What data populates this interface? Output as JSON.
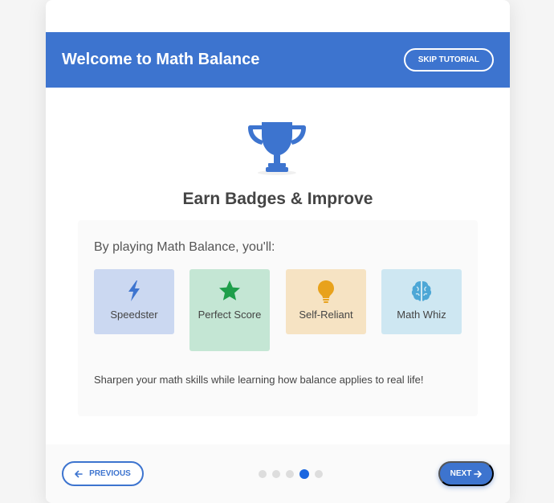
{
  "header": {
    "title": "Welcome to Math Balance",
    "skip_label": "SKIP TUTORIAL"
  },
  "main": {
    "icon": "trophy-icon",
    "title": "Earn Badges & Improve",
    "intro": "By playing Math Balance, you'll:",
    "badges": [
      {
        "label": "Speedster",
        "icon": "lightning-icon",
        "color": "#cbd8f1"
      },
      {
        "label": "Perfect Score",
        "icon": "star-icon",
        "color": "#c4e6d4"
      },
      {
        "label": "Self-Reliant",
        "icon": "lightbulb-icon",
        "color": "#f6e3c3"
      },
      {
        "label": "Math Whiz",
        "icon": "brain-icon",
        "color": "#cee7f2"
      }
    ],
    "description": "Sharpen your math skills while learning how balance applies to real life!"
  },
  "footer": {
    "prev_label": "PREVIOUS",
    "next_label": "NEXT",
    "steps_total": 5,
    "current_step": 4
  },
  "colors": {
    "primary": "#3d74cf",
    "active_dot": "#1a66e0"
  }
}
